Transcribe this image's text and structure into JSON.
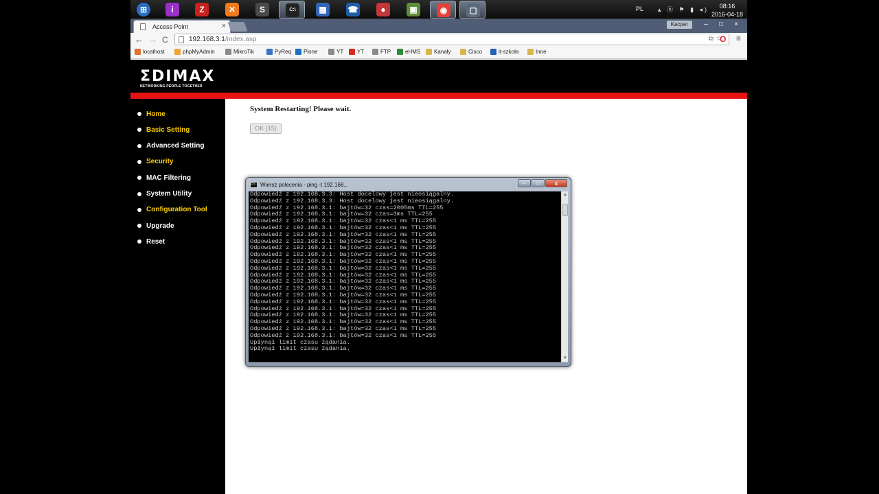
{
  "taskbar": {
    "apps": [
      {
        "name": "windows-start-icon",
        "glyph": "⊞",
        "color": "#2a6fc4"
      },
      {
        "name": "app-purple-icon",
        "glyph": "i",
        "color": "#9b2fc9"
      },
      {
        "name": "filezilla-icon",
        "glyph": "Z",
        "color": "#c8221e"
      },
      {
        "name": "xampp-icon",
        "glyph": "✕",
        "color": "#f17a1b"
      },
      {
        "name": "sublime-icon",
        "glyph": "S",
        "color": "#4a4a4a"
      },
      {
        "name": "cmd-icon",
        "glyph": "C:\\",
        "color": "#222222"
      },
      {
        "name": "network-icon",
        "glyph": "▦",
        "color": "#3266b8"
      },
      {
        "name": "teamspeak-icon",
        "glyph": "☎",
        "color": "#1f5fa8"
      },
      {
        "name": "users-icon",
        "glyph": "●",
        "color": "#c2373b"
      },
      {
        "name": "explorer-icon",
        "glyph": "▣",
        "color": "#5d8f3b"
      },
      {
        "name": "chrome-icon",
        "glyph": "◉",
        "color": "#e3413a"
      },
      {
        "name": "window-icon",
        "glyph": "▢",
        "color": "#5d6a7b"
      }
    ],
    "lang": "PL",
    "tray_icons": "▴ ⓑ ⚑ ▮ ◂)",
    "time": "08:16",
    "date": "2016-04-18"
  },
  "browser": {
    "tab_title": "Access Point",
    "tab_close": "×",
    "profile": "Kacper",
    "window_controls": [
      "–",
      "□",
      "×"
    ],
    "back": "←",
    "forward": "→",
    "reload": "C",
    "url_host": "192.168.3.1",
    "url_path": "/index.asp",
    "omnibox_right": "⧉☆",
    "opera": "O",
    "menu": "≡",
    "bookmarks": [
      {
        "label": "localhost",
        "color": "#e36f2d"
      },
      {
        "label": "phpMyAdmin",
        "color": "#f0a23a"
      },
      {
        "label": "MikroTik",
        "color": "#8a8a8a"
      },
      {
        "label": "PyReq",
        "color": "#3a74c4"
      },
      {
        "label": "Plone",
        "color": "#1b73c7"
      },
      {
        "label": "YT",
        "color": "#8a8a8a"
      },
      {
        "label": "YT",
        "color": "#d42b1f"
      },
      {
        "label": "FTP",
        "color": "#8a8a8a"
      },
      {
        "label": "eHMS",
        "color": "#2c8d3a"
      },
      {
        "label": "Kanały",
        "color": "#d8b64e"
      },
      {
        "label": "Cisco",
        "color": "#d8b64e"
      },
      {
        "label": "it-szkoła",
        "color": "#2462b8"
      },
      {
        "label": "Inne",
        "color": "#d8b64e"
      }
    ]
  },
  "page": {
    "logo_text": "ΣDIMAX",
    "logo_tagline": "NETWORKING PEOPLE TOGETHER",
    "menu": [
      {
        "label": "Home",
        "yellow": true
      },
      {
        "label": "Basic Setting",
        "yellow": true
      },
      {
        "label": "Advanced Setting",
        "yellow": false
      },
      {
        "label": "Security",
        "yellow": true
      },
      {
        "label": "MAC Filtering",
        "yellow": false
      },
      {
        "label": "System Utility",
        "yellow": false
      },
      {
        "label": "Configuration Tool",
        "yellow": true
      },
      {
        "label": "Upgrade",
        "yellow": false
      },
      {
        "label": "Reset",
        "yellow": false
      }
    ],
    "message": "System Restarting! Please wait.",
    "ok_button": "OK (15)"
  },
  "cmd": {
    "title": "Wiersz polecenia - ping  -t 192.168...",
    "icon": "C:\\",
    "controls": [
      "–",
      "□",
      "x"
    ],
    "scroll_up": "▲",
    "scroll_down": "▼",
    "lines": [
      "Odpowiedź z 192.168.3.3: Host docelowy jest nieosiągalny.",
      "Odpowiedź z 192.168.3.3: Host docelowy jest nieosiągalny.",
      "Odpowiedź z 192.168.3.1: bajtów=32 czas=2005ms TTL=255",
      "Odpowiedź z 192.168.3.1: bajtów=32 czas=3ms TTL=255",
      "Odpowiedź z 192.168.3.1: bajtów=32 czas<1 ms TTL=255",
      "Odpowiedź z 192.168.3.1: bajtów=32 czas<1 ms TTL=255",
      "Odpowiedź z 192.168.3.1: bajtów=32 czas<1 ms TTL=255",
      "Odpowiedź z 192.168.3.1: bajtów=32 czas<1 ms TTL=255",
      "Odpowiedź z 192.168.3.1: bajtów=32 czas<1 ms TTL=255",
      "Odpowiedź z 192.168.3.1: bajtów=32 czas<1 ms TTL=255",
      "Odpowiedź z 192.168.3.1: bajtów=32 czas<1 ms TTL=255",
      "Odpowiedź z 192.168.3.1: bajtów=32 czas<1 ms TTL=255",
      "Odpowiedź z 192.168.3.1: bajtów=32 czas<1 ms TTL=255",
      "Odpowiedź z 192.168.3.1: bajtów=32 czas<1 ms TTL=255",
      "Odpowiedź z 192.168.3.1: bajtów=32 czas<1 ms TTL=255",
      "Odpowiedź z 192.168.3.1: bajtów=32 czas<1 ms TTL=255",
      "Odpowiedź z 192.168.3.1: bajtów=32 czas<1 ms TTL=255",
      "Odpowiedź z 192.168.3.1: bajtów=32 czas<1 ms TTL=255",
      "Odpowiedź z 192.168.3.1: bajtów=32 czas<1 ms TTL=255",
      "Odpowiedź z 192.168.3.1: bajtów=32 czas<1 ms TTL=255",
      "Odpowiedź z 192.168.3.1: bajtów=32 czas<1 ms TTL=255",
      "Odpowiedź z 192.168.3.1: bajtów=32 czas<1 ms TTL=255",
      "Upłynął limit czasu żądania.",
      "Upłynął limit czasu żądania."
    ]
  }
}
